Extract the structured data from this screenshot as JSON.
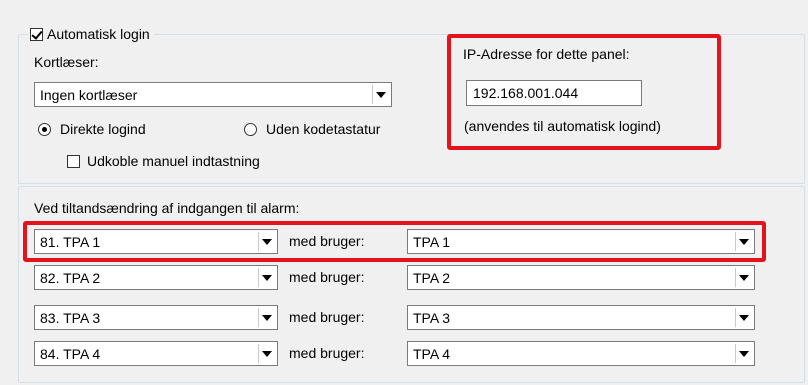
{
  "login_section": {
    "auto_login_label": "Automatisk login",
    "auto_login_checked": true,
    "card_reader_label": "Kortlæser:",
    "card_reader_value": "Ingen kortlæser",
    "radio_direct_label": "Direkte logind",
    "radio_no_keypad_label": "Uden kodetastatur",
    "selected_radio": "Direkte logind",
    "disable_manual_label": "Udkoble manuel indtastning",
    "disable_manual_checked": false,
    "ip_label": "IP-Adresse for dette panel:",
    "ip_value": "192.168.001.044",
    "ip_note": "(anvendes til automatisk logind)"
  },
  "alarm_section": {
    "heading": "Ved tiltandsændring af indgangen til alarm:",
    "with_user_label": "med bruger:",
    "rows": [
      {
        "input": "81. TPA 1",
        "user": "TPA 1"
      },
      {
        "input": "82. TPA 2",
        "user": "TPA 2"
      },
      {
        "input": "83. TPA 3",
        "user": "TPA 3"
      },
      {
        "input": "84. TPA 4",
        "user": "TPA 4"
      }
    ]
  },
  "colors": {
    "highlight": "#e3121d",
    "groupbox_border": "#d5dfe5",
    "background": "#f0f0f0"
  }
}
